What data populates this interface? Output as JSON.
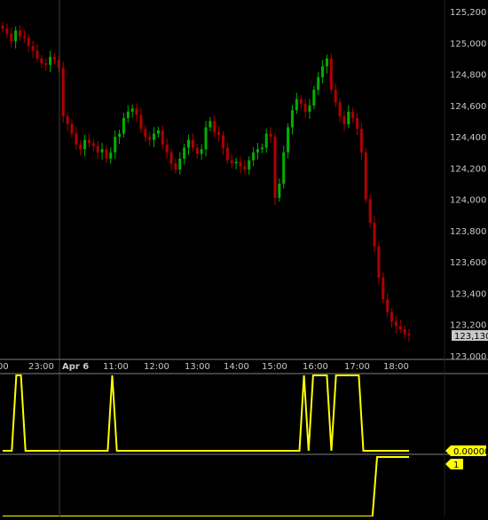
{
  "chart_data": {
    "type": "candlestick",
    "x_ticks": [
      "00",
      "23:00",
      "Apr 6",
      "11:00",
      "12:00",
      "13:00",
      "14:00",
      "15:00",
      "16:00",
      "17:00",
      "18:00"
    ],
    "price_axis": {
      "ticks": [
        "125,200",
        "125,000",
        "124,800",
        "124,600",
        "124,400",
        "124,200",
        "124,000",
        "123,800",
        "123,600",
        "123,400",
        "123,200",
        "123,000"
      ],
      "ylim": [
        122,
        980,
        125,
        230
      ],
      "last_price_label": "123,130",
      "last_price": 123130
    },
    "candles_close_path": [
      125090,
      125060,
      125010,
      125080,
      125040,
      125030,
      124980,
      124950,
      124900,
      124870,
      124860,
      124910,
      124890,
      124840,
      124530,
      124480,
      124420,
      124350,
      124320,
      124380,
      124360,
      124340,
      124300,
      124320,
      124260,
      124300,
      124400,
      124420,
      124520,
      124560,
      124580,
      124540,
      124450,
      124400,
      124380,
      124420,
      124440,
      124350,
      124300,
      124230,
      124190,
      124260,
      124330,
      124380,
      124330,
      124290,
      124320,
      124460,
      124500,
      124430,
      124410,
      124330,
      124250,
      124230,
      124240,
      124210,
      124190,
      124250,
      124300,
      124320,
      124330,
      124420,
      124400,
      124010,
      124100,
      124300,
      124460,
      124570,
      124640,
      124610,
      124560,
      124600,
      124700,
      124780,
      124850,
      124900,
      124700,
      124620,
      124530,
      124480,
      124560,
      124520,
      124450,
      124300,
      124000,
      123850,
      123700,
      123500,
      123360,
      123280,
      123220,
      123190,
      123170,
      123140,
      123130
    ],
    "indicator_1": {
      "value_label": "0.00000",
      "levels": [
        0,
        0,
        0,
        1,
        1,
        0,
        0,
        0,
        0,
        0,
        0,
        0,
        0,
        0,
        0,
        0,
        0,
        0,
        0,
        0,
        0,
        0,
        0,
        0,
        1,
        0,
        0,
        0,
        0,
        0,
        0,
        0,
        0,
        0,
        0,
        0,
        0,
        0,
        0,
        0,
        0,
        0,
        0,
        0,
        0,
        0,
        0,
        0,
        0,
        0,
        0,
        0,
        0,
        0,
        0,
        0,
        0,
        0,
        0,
        0,
        0,
        0,
        0,
        0,
        0,
        0,
        1,
        0,
        1,
        1,
        1,
        1,
        0,
        1,
        1,
        1,
        1,
        1,
        1,
        0,
        0,
        0,
        0,
        0,
        0,
        0,
        0,
        0,
        0,
        0
      ]
    },
    "indicator_2": {
      "value_label": "1",
      "levels": [
        0,
        0,
        0,
        0,
        0,
        0,
        0,
        0,
        0,
        0,
        0,
        0,
        0,
        0,
        0,
        0,
        0,
        0,
        0,
        0,
        0,
        0,
        0,
        0,
        0,
        0,
        0,
        0,
        0,
        0,
        0,
        0,
        0,
        0,
        0,
        0,
        0,
        0,
        0,
        0,
        0,
        0,
        0,
        0,
        0,
        0,
        0,
        0,
        0,
        0,
        0,
        0,
        0,
        0,
        0,
        0,
        0,
        0,
        0,
        0,
        0,
        0,
        0,
        0,
        0,
        0,
        0,
        0,
        0,
        0,
        0,
        0,
        0,
        0,
        0,
        0,
        0,
        0,
        0,
        0,
        0,
        0,
        1,
        1,
        1,
        1,
        1,
        1,
        1,
        1
      ]
    },
    "colors": {
      "background": "#000000",
      "up": "#00b000",
      "down": "#b00000",
      "indicator": "#ffff00",
      "axis_text": "#c8c8c8",
      "separator": "#808080",
      "price_label_bg": "#c8c8c8"
    }
  }
}
